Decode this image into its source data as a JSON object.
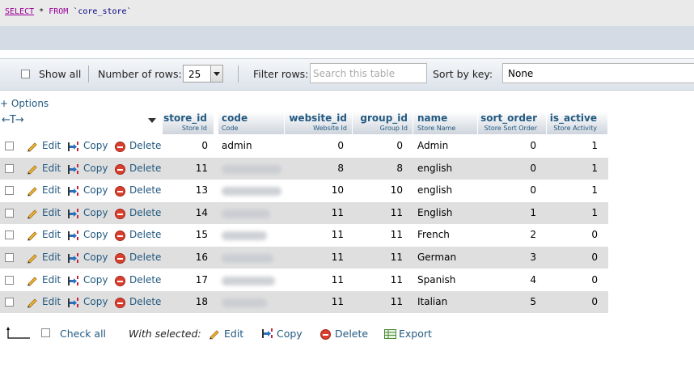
{
  "sql": {
    "select": "SELECT",
    "star": "*",
    "from": "FROM",
    "table": "`core_store`"
  },
  "navbar": {
    "show_all": "Show all",
    "num_rows_label": "Number of rows:",
    "num_rows_value": "25",
    "filter_label": "Filter rows:",
    "filter_placeholder": "Search this table",
    "sort_label": "Sort by key:",
    "sort_value": "None"
  },
  "options_link": "+ Options",
  "arrows": "←T→",
  "columns": [
    {
      "name": "store_id",
      "comment": "Store Id"
    },
    {
      "name": "code",
      "comment": "Code"
    },
    {
      "name": "website_id",
      "comment": "Website Id"
    },
    {
      "name": "group_id",
      "comment": "Group Id"
    },
    {
      "name": "name",
      "comment": "Store Name"
    },
    {
      "name": "sort_order",
      "comment": "Store Sort Order"
    },
    {
      "name": "is_active",
      "comment": "Store Activity"
    }
  ],
  "actions": {
    "edit": "Edit",
    "copy": "Copy",
    "delete": "Delete"
  },
  "rows": [
    {
      "store_id": "0",
      "code": "admin",
      "website_id": "0",
      "group_id": "0",
      "name": "Admin",
      "sort_order": "0",
      "is_active": "1"
    },
    {
      "store_id": "11",
      "code": "",
      "website_id": "8",
      "group_id": "8",
      "name": "english",
      "sort_order": "0",
      "is_active": "1"
    },
    {
      "store_id": "13",
      "code": "",
      "website_id": "10",
      "group_id": "10",
      "name": "english",
      "sort_order": "0",
      "is_active": "1"
    },
    {
      "store_id": "14",
      "code": "",
      "website_id": "11",
      "group_id": "11",
      "name": "English",
      "sort_order": "1",
      "is_active": "1"
    },
    {
      "store_id": "15",
      "code": "",
      "website_id": "11",
      "group_id": "11",
      "name": "French",
      "sort_order": "2",
      "is_active": "0"
    },
    {
      "store_id": "16",
      "code": "",
      "website_id": "11",
      "group_id": "11",
      "name": "German",
      "sort_order": "3",
      "is_active": "0"
    },
    {
      "store_id": "17",
      "code": "",
      "website_id": "11",
      "group_id": "11",
      "name": "Spanish",
      "sort_order": "4",
      "is_active": "0"
    },
    {
      "store_id": "18",
      "code": "",
      "website_id": "11",
      "group_id": "11",
      "name": "Italian",
      "sort_order": "5",
      "is_active": "0"
    }
  ],
  "bottom": {
    "check_all": "Check all",
    "with_selected": "With selected:",
    "edit": "Edit",
    "copy": "Copy",
    "delete": "Delete",
    "export": "Export"
  }
}
